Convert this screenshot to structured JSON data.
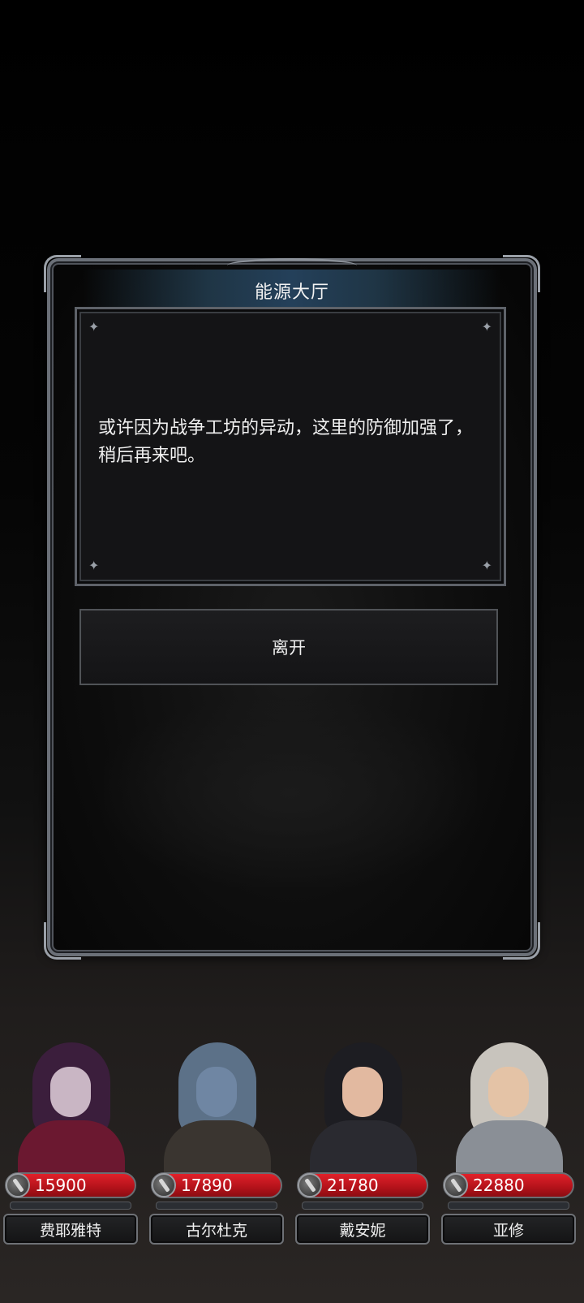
{
  "dialog": {
    "title": "能源大厅",
    "message": "或许因为战争工坊的异动，这里的防御加强了，稍后再来吧。",
    "leave_label": "离开"
  },
  "party": [
    {
      "name": "费耶雅特",
      "hp": "15900",
      "portrait_colors": {
        "hood": "#3b1e3c",
        "face": "#c9b6c4",
        "body": "#6b1830"
      }
    },
    {
      "name": "古尔杜克",
      "hp": "17890",
      "portrait_colors": {
        "hood": "#5c7188",
        "face": "#6f86a3",
        "body": "#3a3530"
      }
    },
    {
      "name": "戴安妮",
      "hp": "21780",
      "portrait_colors": {
        "hood": "#1d1d22",
        "face": "#e2b9a0",
        "body": "#2a2a30"
      }
    },
    {
      "name": "亚修",
      "hp": "22880",
      "portrait_colors": {
        "hood": "#c8c4bd",
        "face": "#e4c3a6",
        "body": "#8a8f96"
      }
    }
  ],
  "icons": {
    "hp": "sword-icon",
    "sparkle": "sparkle-icon"
  },
  "colors": {
    "hp_bar": "#c4161e",
    "title_bar": "#24405a",
    "frame": "#6b7078"
  }
}
